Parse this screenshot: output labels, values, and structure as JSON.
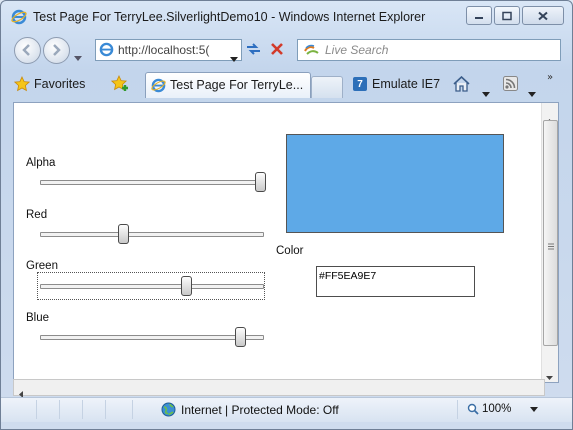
{
  "window": {
    "title": "Test Page For TerryLee.SilverlightDemo10 - Windows Internet Explorer"
  },
  "nav": {
    "address": "http://localhost:5(",
    "search_placeholder": "Live Search"
  },
  "toolbar": {
    "favorites_label": "Favorites",
    "tab_label": "Test Page For TerryLe...",
    "emulate_label": "Emulate IE7",
    "chevron": "»"
  },
  "app": {
    "sliders": [
      {
        "label": "Alpha",
        "value": 1.0
      },
      {
        "label": "Red",
        "value": 0.37
      },
      {
        "label": "Green",
        "value": 0.66
      },
      {
        "label": "Blue",
        "value": 0.91
      }
    ],
    "color_label": "Color",
    "hex_value": "#FF5EA9E7",
    "swatch_color": "#5EA9E7"
  },
  "status": {
    "zone_text": "Internet | Protected Mode: Off",
    "zoom": "100%"
  }
}
